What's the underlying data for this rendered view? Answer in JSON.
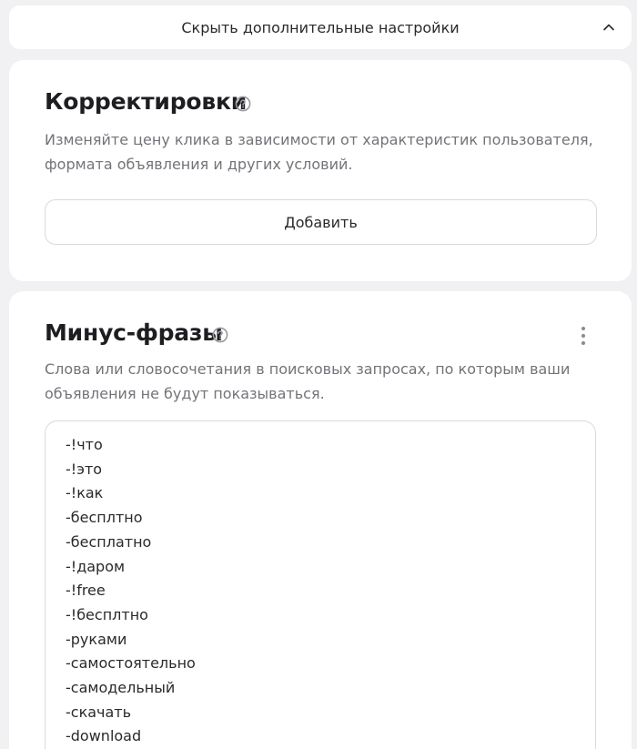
{
  "toggle": {
    "label": "Скрыть дополнительные настройки"
  },
  "adjustments": {
    "title": "Корректировки",
    "description": "Изменяйте цену клика в зависимости от характеристик пользователя, формата объявления и других условий.",
    "add_button_label": "Добавить"
  },
  "minus_phrases": {
    "title": "Минус-фразы",
    "description": "Слова или словосочетания в поисковых запросах, по которым ваши объявления не будут показываться.",
    "items": [
      "-!что",
      "-!это",
      "-!как",
      "-бесплтно",
      "-бесплатно",
      "-!даром",
      "-!free",
      "-!бесплтно",
      "-руками",
      "-самостоятельно",
      "-самодельный",
      "-скачать",
      "-download"
    ]
  },
  "icons": {
    "toggle": "chevron-up-icon",
    "help": "question-circle-icon",
    "menu": "kebab-menu-icon"
  },
  "colors": {
    "background": "#f1f1f3",
    "card": "#ffffff",
    "text": "#2a2a2e",
    "muted_text": "#737379",
    "border": "#d9d9de"
  }
}
